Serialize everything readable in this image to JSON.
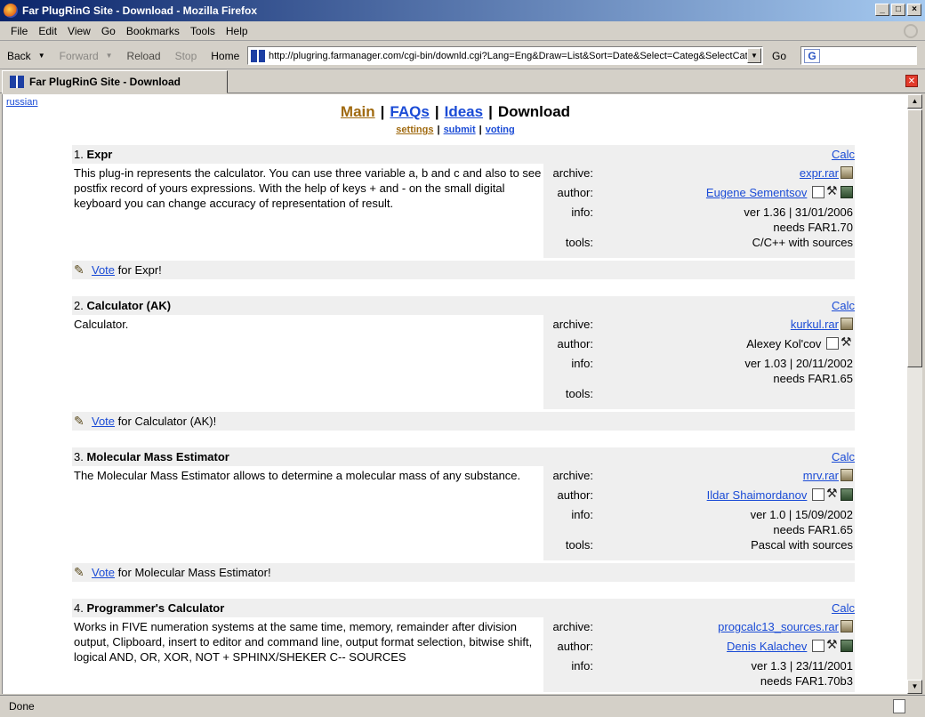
{
  "window": {
    "title": "Far PlugRinG Site - Download - Mozilla Firefox"
  },
  "menu": [
    "File",
    "Edit",
    "View",
    "Go",
    "Bookmarks",
    "Tools",
    "Help"
  ],
  "toolbar": {
    "back": "Back",
    "forward": "Forward",
    "reload": "Reload",
    "stop": "Stop",
    "home": "Home",
    "go": "Go"
  },
  "address": {
    "url": "http://plugring.farmanager.com/cgi-bin/downld.cgi?Lang=Eng&Draw=List&Sort=Date&Select=Categ&SelectCateg"
  },
  "tab": {
    "title": "Far PlugRinG Site - Download"
  },
  "status": {
    "text": "Done"
  },
  "page": {
    "lang_link": "russian",
    "nav": {
      "main": "Main",
      "faqs": "FAQs",
      "ideas": "Ideas",
      "download": "Download",
      "sep": "|"
    },
    "subnav": {
      "settings": "settings",
      "submit": "submit",
      "voting": "voting",
      "sep": "|"
    },
    "labels": {
      "archive": "archive:",
      "author": "author:",
      "info": "info:",
      "tools": "tools:",
      "vote": "Vote"
    }
  },
  "entries": [
    {
      "num": "1.",
      "title": "Expr",
      "category": "Calc",
      "desc": "This plug-in represents the calculator. You can use three variable a, b and c and also to see postfix record of yours expressions. With the help of keys + and - on the small digital keyboard you can change accuracy of representation of result.",
      "archive": "expr.rar",
      "author": "Eugene Sementsov",
      "info1": "ver 1.36 | 31/01/2006",
      "info2": "needs FAR1.70",
      "tools": "C/C++ with sources",
      "vote_for": "for Expr!"
    },
    {
      "num": "2.",
      "title": "Calculator (AK)",
      "category": "Calc",
      "desc": "Calculator.",
      "archive": "kurkul.rar",
      "author": "Alexey Kol'cov",
      "info1": "ver 1.03 | 20/11/2002",
      "info2": "needs FAR1.65",
      "tools": "",
      "vote_for": "for Calculator (AK)!"
    },
    {
      "num": "3.",
      "title": "Molecular Mass Estimator",
      "category": "Calc",
      "desc": "The Molecular Mass Estimator allows to determine a molecular mass of any substance.",
      "archive": "mrv.rar",
      "author": "Ildar Shaimordanov",
      "info1": "ver 1.0 | 15/09/2002",
      "info2": "needs FAR1.65",
      "tools": "Pascal with sources",
      "vote_for": "for Molecular Mass Estimator!"
    },
    {
      "num": "4.",
      "title": "Programmer's Calculator",
      "category": "Calc",
      "desc": "Works in FIVE numeration systems at the same time, memory, remainder after division output, Clipboard, insert to editor and command line, output format selection, bitwise shift, logical AND, OR, XOR, NOT + SPHINX/SHEKER C-- SOURCES",
      "archive": "progcalc13_sources.rar",
      "author": "Denis Kalachev",
      "info1": "ver 1.3 | 23/11/2001",
      "info2": "needs FAR1.70b3"
    }
  ]
}
